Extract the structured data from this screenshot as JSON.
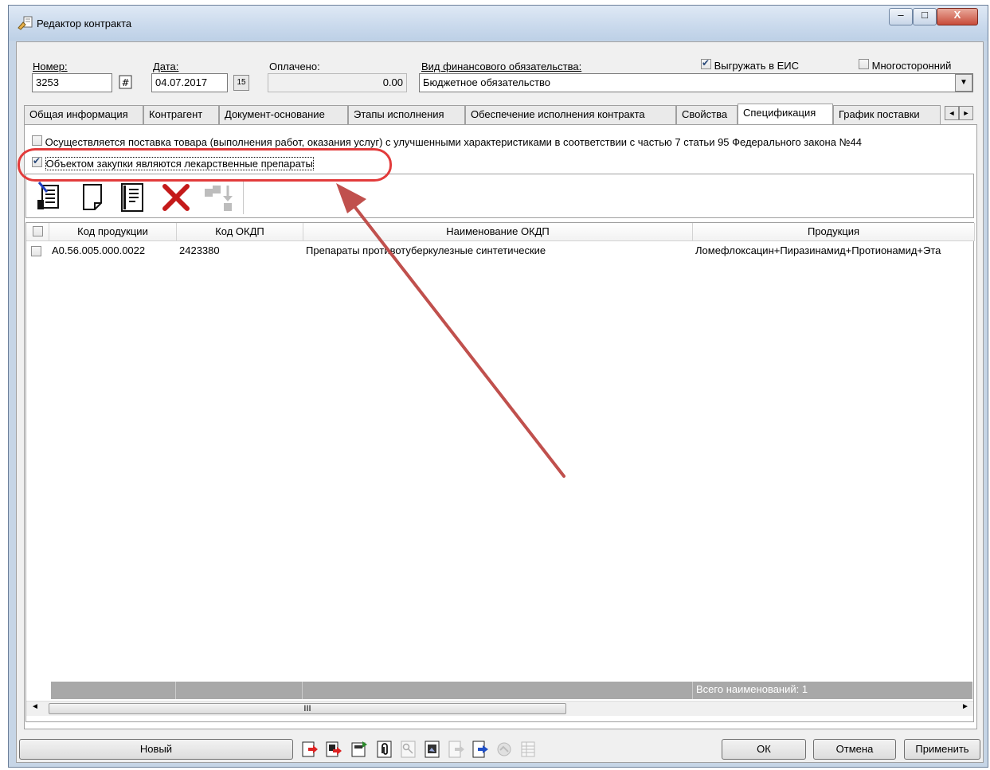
{
  "window": {
    "title": "Редактор контракта",
    "controls": {
      "minimize": "–",
      "maximize": "□",
      "close": "X"
    }
  },
  "header": {
    "number_label": "Номер:",
    "number_value": "3253",
    "date_label": "Дата:",
    "date_value": "04.07.2017",
    "paid_label": "Оплачено:",
    "paid_value": "0.00",
    "obligation_label": "Вид финансового обязательства:",
    "obligation_value": "Бюджетное обязательство",
    "export_eis_label": "Выгружать в ЕИС",
    "export_eis_checked": true,
    "multilateral_label": "Многосторонний",
    "multilateral_checked": false,
    "calendar_button": "15"
  },
  "tabs": [
    "Общая информация",
    "Контрагент",
    "Документ-основание",
    "Этапы исполнения",
    "Обеспечение исполнения контракта",
    "Свойства",
    "Спецификация",
    "График поставки"
  ],
  "active_tab": "Спецификация",
  "spec": {
    "improved_goods_label": "Осуществляется поставка товара (выполнения работ, оказания услуг) с улучшенными характеристиками в соответствии с частью 7 статьи 95 Федерального закона №44",
    "improved_goods_checked": false,
    "medicines_label": "Объектом закупки являются лекарственные препараты",
    "medicines_checked": true
  },
  "toolbar_icons": [
    "edit-document-icon",
    "new-document-icon",
    "list-document-icon",
    "delete-icon",
    "move-disabled-icon"
  ],
  "table": {
    "columns": [
      "Код продукции",
      "Код ОКДП",
      "Наименование ОКДП",
      "Продукция"
    ],
    "rows": [
      [
        "A0.56.005.000.0022",
        "2423380",
        "Препараты противотуберкулезные синтетические",
        "Ломефлоксацин+Пиразинамид+Протионамид+Эта"
      ]
    ],
    "footer_total": "Всего наименований: 1",
    "scroll_thumb_grip": "III"
  },
  "bottom": {
    "new_label": "Новый",
    "ok_label": "ОК",
    "cancel_label": "Отмена",
    "apply_label": "Применить"
  },
  "colors": {
    "annotation": "#e23b3b",
    "arrow": "#c0504d",
    "window_frame": "#c6d5e6"
  }
}
